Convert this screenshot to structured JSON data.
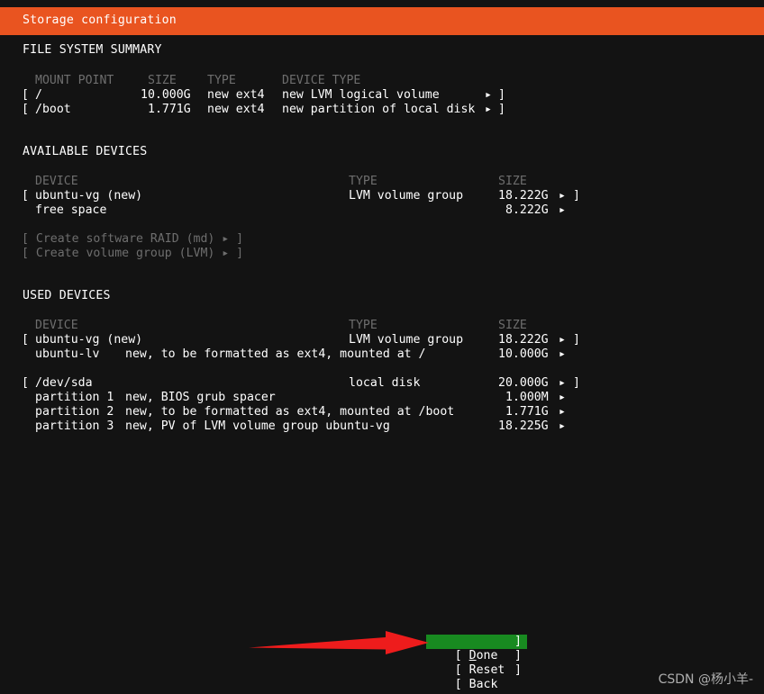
{
  "header": {
    "title": "Storage configuration",
    "bar_color": "#e95420"
  },
  "colors": {
    "background": "#131313",
    "accent_orange": "#e95420",
    "selected_green": "#188a20",
    "dim_text": "#6e6e6e",
    "text": "#ffffff",
    "annotation_red": "#ee1c1c"
  },
  "filesystem_summary": {
    "section_label": "FILE SYSTEM SUMMARY",
    "columns": [
      "MOUNT POINT",
      "SIZE",
      "TYPE",
      "DEVICE TYPE"
    ],
    "rows": [
      {
        "open_bracket": "[",
        "mount_point": "/",
        "size": "10.000G",
        "type": "new ext4",
        "device_type": "new LVM logical volume",
        "arrow": "▸",
        "close_bracket": "]"
      },
      {
        "open_bracket": "[",
        "mount_point": "/boot",
        "size": "1.771G",
        "type": "new ext4",
        "device_type": "new partition of local disk",
        "arrow": "▸",
        "close_bracket": "]"
      }
    ]
  },
  "available_devices": {
    "section_label": "AVAILABLE DEVICES",
    "columns": [
      "DEVICE",
      "TYPE",
      "SIZE"
    ],
    "rows": [
      {
        "open_bracket": "[",
        "device": "ubuntu-vg (new)",
        "type": "LVM volume group",
        "size": "18.222G",
        "arrow": "▸",
        "close_bracket": "]"
      },
      {
        "open_bracket": "",
        "device": "free space",
        "type": "",
        "size": "8.222G",
        "arrow": "▸",
        "close_bracket": ""
      }
    ],
    "actions": [
      {
        "label": "[ Create software RAID (md) ▸ ]",
        "enabled": false
      },
      {
        "label": "[ Create volume group (LVM) ▸ ]",
        "enabled": false
      }
    ]
  },
  "used_devices": {
    "section_label": "USED DEVICES",
    "columns": [
      "DEVICE",
      "TYPE",
      "SIZE"
    ],
    "groups": [
      {
        "header": {
          "open_bracket": "[",
          "device": "ubuntu-vg (new)",
          "type": "LVM volume group",
          "size": "18.222G",
          "arrow": "▸",
          "close_bracket": "]"
        },
        "children": [
          {
            "device": "ubuntu-lv",
            "detail": "new, to be formatted as ext4, mounted at /",
            "size": "10.000G",
            "arrow": "▸"
          }
        ]
      },
      {
        "header": {
          "open_bracket": "[",
          "device": "/dev/sda",
          "type": "local disk",
          "size": "20.000G",
          "arrow": "▸",
          "close_bracket": "]"
        },
        "children": [
          {
            "device": "partition 1",
            "detail": "new, BIOS grub spacer",
            "size": "1.000M",
            "arrow": "▸"
          },
          {
            "device": "partition 2",
            "detail": "new, to be formatted as ext4, mounted at /boot",
            "size": "1.771G",
            "arrow": "▸"
          },
          {
            "device": "partition 3",
            "detail": "new, PV of LVM volume group ubuntu-vg",
            "size": "18.225G",
            "arrow": "▸"
          }
        ]
      }
    ]
  },
  "buttons": [
    {
      "open": "[ ",
      "accel": "D",
      "rest": "one",
      "close": "]",
      "selected": true
    },
    {
      "open": "[ ",
      "accel": "R",
      "rest": "eset",
      "close": "]",
      "selected": false
    },
    {
      "open": "[ ",
      "accel": "B",
      "rest": "ack",
      "close": "]",
      "selected": false
    }
  ],
  "annotation": {
    "type": "arrow",
    "points_to": "Done"
  },
  "watermark": {
    "text": "CSDN @杨小羊-"
  }
}
